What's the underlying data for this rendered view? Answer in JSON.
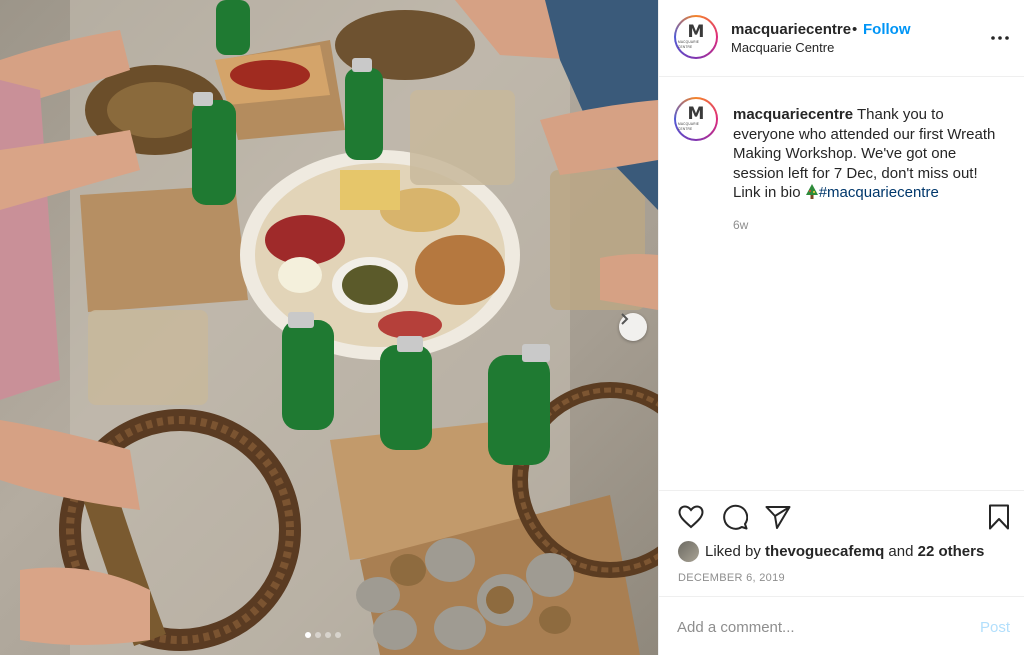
{
  "post": {
    "username": "macquariecentre",
    "separator": "•",
    "follow_label": "Follow",
    "location": "Macquarie Centre",
    "avatar": {
      "letter": "M",
      "subtext": "MACQUARIE CENTRE"
    },
    "caption": {
      "username": "macquariecentre",
      "text": "Thank you to everyone who attended our first Wreath Making Workshop. We've got one session left for 7 Dec, don't miss out! Link in bio",
      "emoji": "christmas-tree-icon",
      "hashtag": "#macquariecentre",
      "age": "6w"
    },
    "likes": {
      "prefix": "Liked by",
      "liker": "thevoguecafemq",
      "middle": "and",
      "others": "22 others"
    },
    "date": "DECEMBER 6, 2019",
    "comment_placeholder": "Add a comment...",
    "post_label": "Post"
  },
  "carousel": {
    "slide_count": 4,
    "active_index": 0
  },
  "colors": {
    "follow": "#0095f6",
    "hashtag": "#00376b",
    "muted": "#8e8e8e",
    "post_disabled": "#b2dffc"
  }
}
